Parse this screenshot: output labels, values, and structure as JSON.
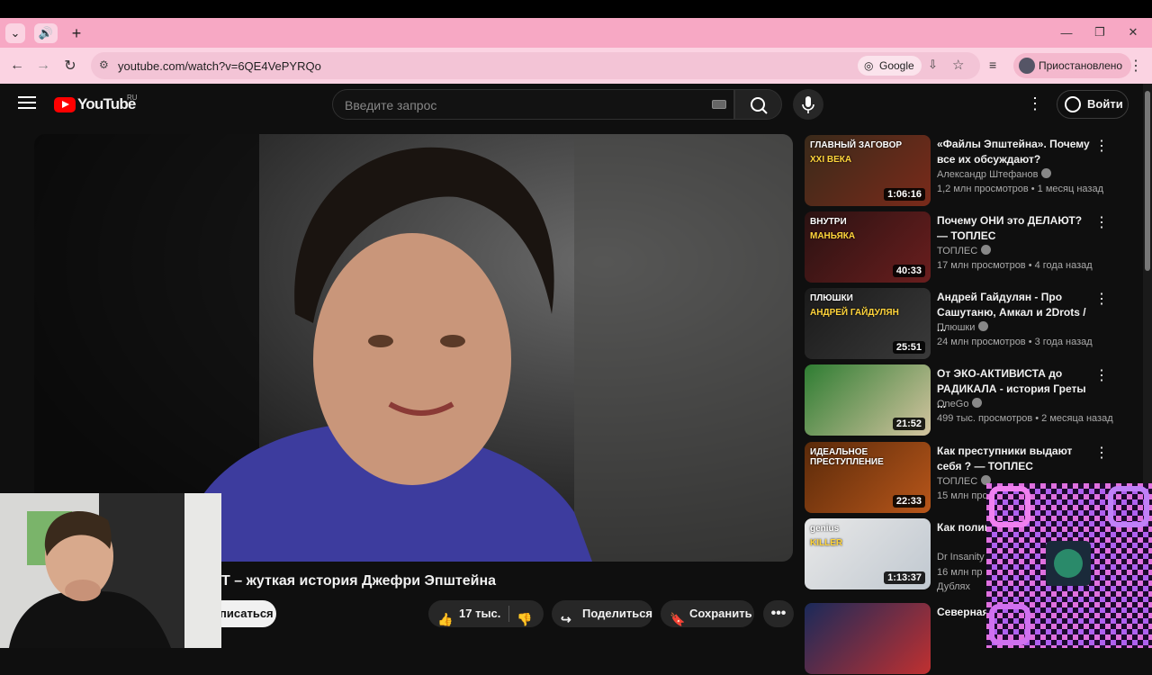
{
  "browser": {
    "url": "youtube.com/watch?v=6QE4VePYRQo",
    "search_engine_chip": "Google",
    "profile_status": "Приостановлено",
    "new_tab": "+"
  },
  "youtube": {
    "logo_text": "YouTube",
    "region": "RU",
    "search_placeholder": "Введите запрос",
    "signin_label": "Войти"
  },
  "video": {
    "title_visible": "Т – жуткая история Джефри Эпштейна",
    "subscribe_label": "писаться",
    "likes": "17 тыс.",
    "share_label": "Поделиться",
    "save_label": "Сохранить"
  },
  "recommendations": [
    {
      "title": "«Файлы Эпштейна». Почему все их обсуждают?",
      "channel": "Александр Штефанов",
      "verified": true,
      "meta": "1,2 млн просмотров • 1 месяц назад",
      "duration": "1:06:16",
      "thumb_text_1": "ГЛАВНЫЙ ЗАГОВОР",
      "thumb_text_2": "XXI ВЕКА",
      "colors": [
        "#3a2a1a",
        "#7a2a1a"
      ]
    },
    {
      "title": "Почему ОНИ это ДЕЛАЮТ? — ТОПЛЕС",
      "channel": "ТОПЛЕС",
      "verified": true,
      "meta": "17 млн просмотров • 4 года назад",
      "duration": "40:33",
      "thumb_text_1": "ВНУТРИ",
      "thumb_text_2": "МАНЬЯКА",
      "colors": [
        "#2a1212",
        "#6a1e1e"
      ]
    },
    {
      "title": "Андрей Гайдулян - Про Сашутаню, Амкал и 2Drots / ...",
      "channel": "Плюшки",
      "verified": true,
      "meta": "24 млн просмотров • 3 года назад",
      "duration": "25:51",
      "thumb_text_1": "ПЛЮШКИ",
      "thumb_text_2": "АНДРЕЙ ГАЙДУЛЯН",
      "colors": [
        "#1a1a1a",
        "#3a3a3a"
      ]
    },
    {
      "title": "От ЭКО-АКТИВИСТА до РАДИКАЛА - история Греты ...",
      "channel": "OneGo",
      "verified": true,
      "meta": "499 тыс. просмотров • 2 месяца назад",
      "duration": "21:52",
      "thumb_text_1": "",
      "thumb_text_2": "",
      "colors": [
        "#2e7d32",
        "#d4c4a0"
      ]
    },
    {
      "title": "Как преступники выдают себя ? — ТОПЛЕС",
      "channel": "ТОПЛЕС",
      "verified": true,
      "meta": "15 млн просм",
      "duration": "22:33",
      "thumb_text_1": "ИДЕАЛЬНОЕ ПРЕСТУПЛЕНИЕ",
      "thumb_text_2": "",
      "colors": [
        "#5a2a0a",
        "#b8561a"
      ]
    },
    {
      "title": "Как полиц умного уб",
      "channel": "Dr Insanity",
      "verified": false,
      "meta": "16 млн пр",
      "extra": "Дублях",
      "duration": "1:13:37",
      "thumb_text_1": "genius",
      "thumb_text_2": "KILLER",
      "colors": [
        "#e8e8e8",
        "#c0c8d0"
      ]
    },
    {
      "title": "Северная диктатур",
      "channel": "",
      "verified": false,
      "meta": "",
      "duration": "",
      "thumb_text_1": "",
      "thumb_text_2": "",
      "colors": [
        "#1a2a5a",
        "#c03030"
      ]
    }
  ]
}
